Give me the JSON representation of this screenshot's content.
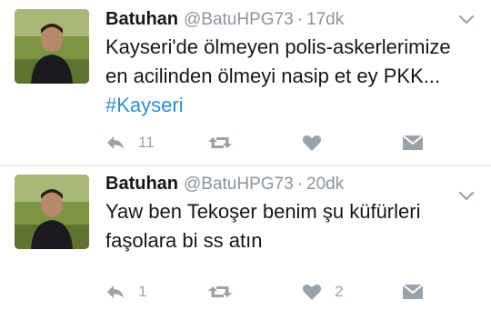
{
  "tweets": [
    {
      "author_name": "Batuhan",
      "handle": "@BatuHPG73",
      "separator": "·",
      "time": "17dk",
      "text": "Kayseri'de ölmeyen polis-askerlerimize en acilinden ölmeyi nasip et ey PKK... ",
      "hashtag": "#Kayseri",
      "reply_count": "11",
      "retweet_count": "",
      "like_count": ""
    },
    {
      "author_name": "Batuhan",
      "handle": "@BatuHPG73",
      "separator": "·",
      "time": "20dk",
      "text": "Yaw ben Tekoşer benim şu küfürleri faşolara bi ss atın",
      "hashtag": "",
      "reply_count": "1",
      "retweet_count": "",
      "like_count": "2"
    }
  ],
  "icons": {
    "reply": "reply-icon",
    "retweet": "retweet-icon",
    "like": "heart-icon",
    "dm": "direct-message-icon",
    "menu": "chevron-down-icon"
  },
  "colors": {
    "text": "#14171a",
    "secondary": "#8a949c",
    "action": "#9aa3aa",
    "hashtag": "#2f8ecb",
    "divider": "#d8dde2"
  }
}
